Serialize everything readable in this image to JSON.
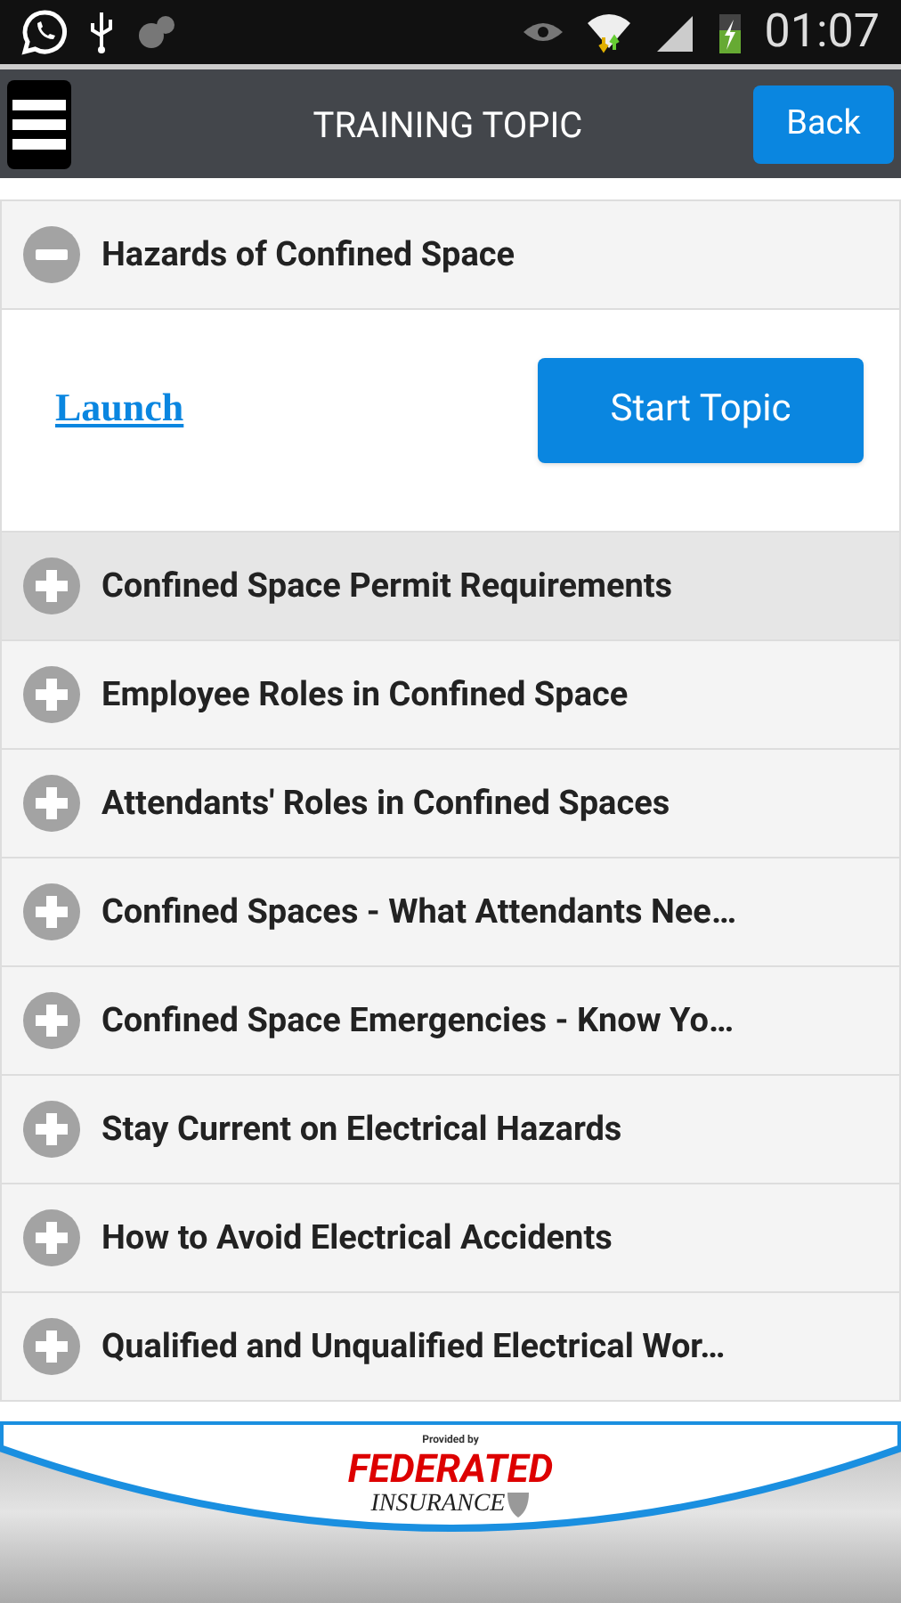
{
  "status_bar": {
    "time": "01:07"
  },
  "app_bar": {
    "title": "TRAINING TOPIC",
    "back_button": "Back"
  },
  "topics": [
    {
      "title": "Hazards of Confined Space",
      "expanded": true,
      "selected": false,
      "launch_link": "Launch",
      "start_button": "Start Topic"
    },
    {
      "title": "Confined Space Permit Requirements",
      "expanded": false,
      "selected": true
    },
    {
      "title": "Employee Roles in Confined Space",
      "expanded": false,
      "selected": false
    },
    {
      "title": "Attendants' Roles in Confined Spaces",
      "expanded": false,
      "selected": false
    },
    {
      "title": "Confined Spaces - What Attendants Nee…",
      "expanded": false,
      "selected": false
    },
    {
      "title": "Confined Space Emergencies - Know Yo…",
      "expanded": false,
      "selected": false
    },
    {
      "title": "Stay Current on Electrical Hazards",
      "expanded": false,
      "selected": false
    },
    {
      "title": "How to Avoid Electrical Accidents",
      "expanded": false,
      "selected": false
    },
    {
      "title": "Qualified and Unqualified Electrical Wor…",
      "expanded": false,
      "selected": false
    }
  ],
  "footer": {
    "provided_by": "Provided by",
    "brand_top": "FEDERATED",
    "brand_bottom": "INSURANCE"
  }
}
